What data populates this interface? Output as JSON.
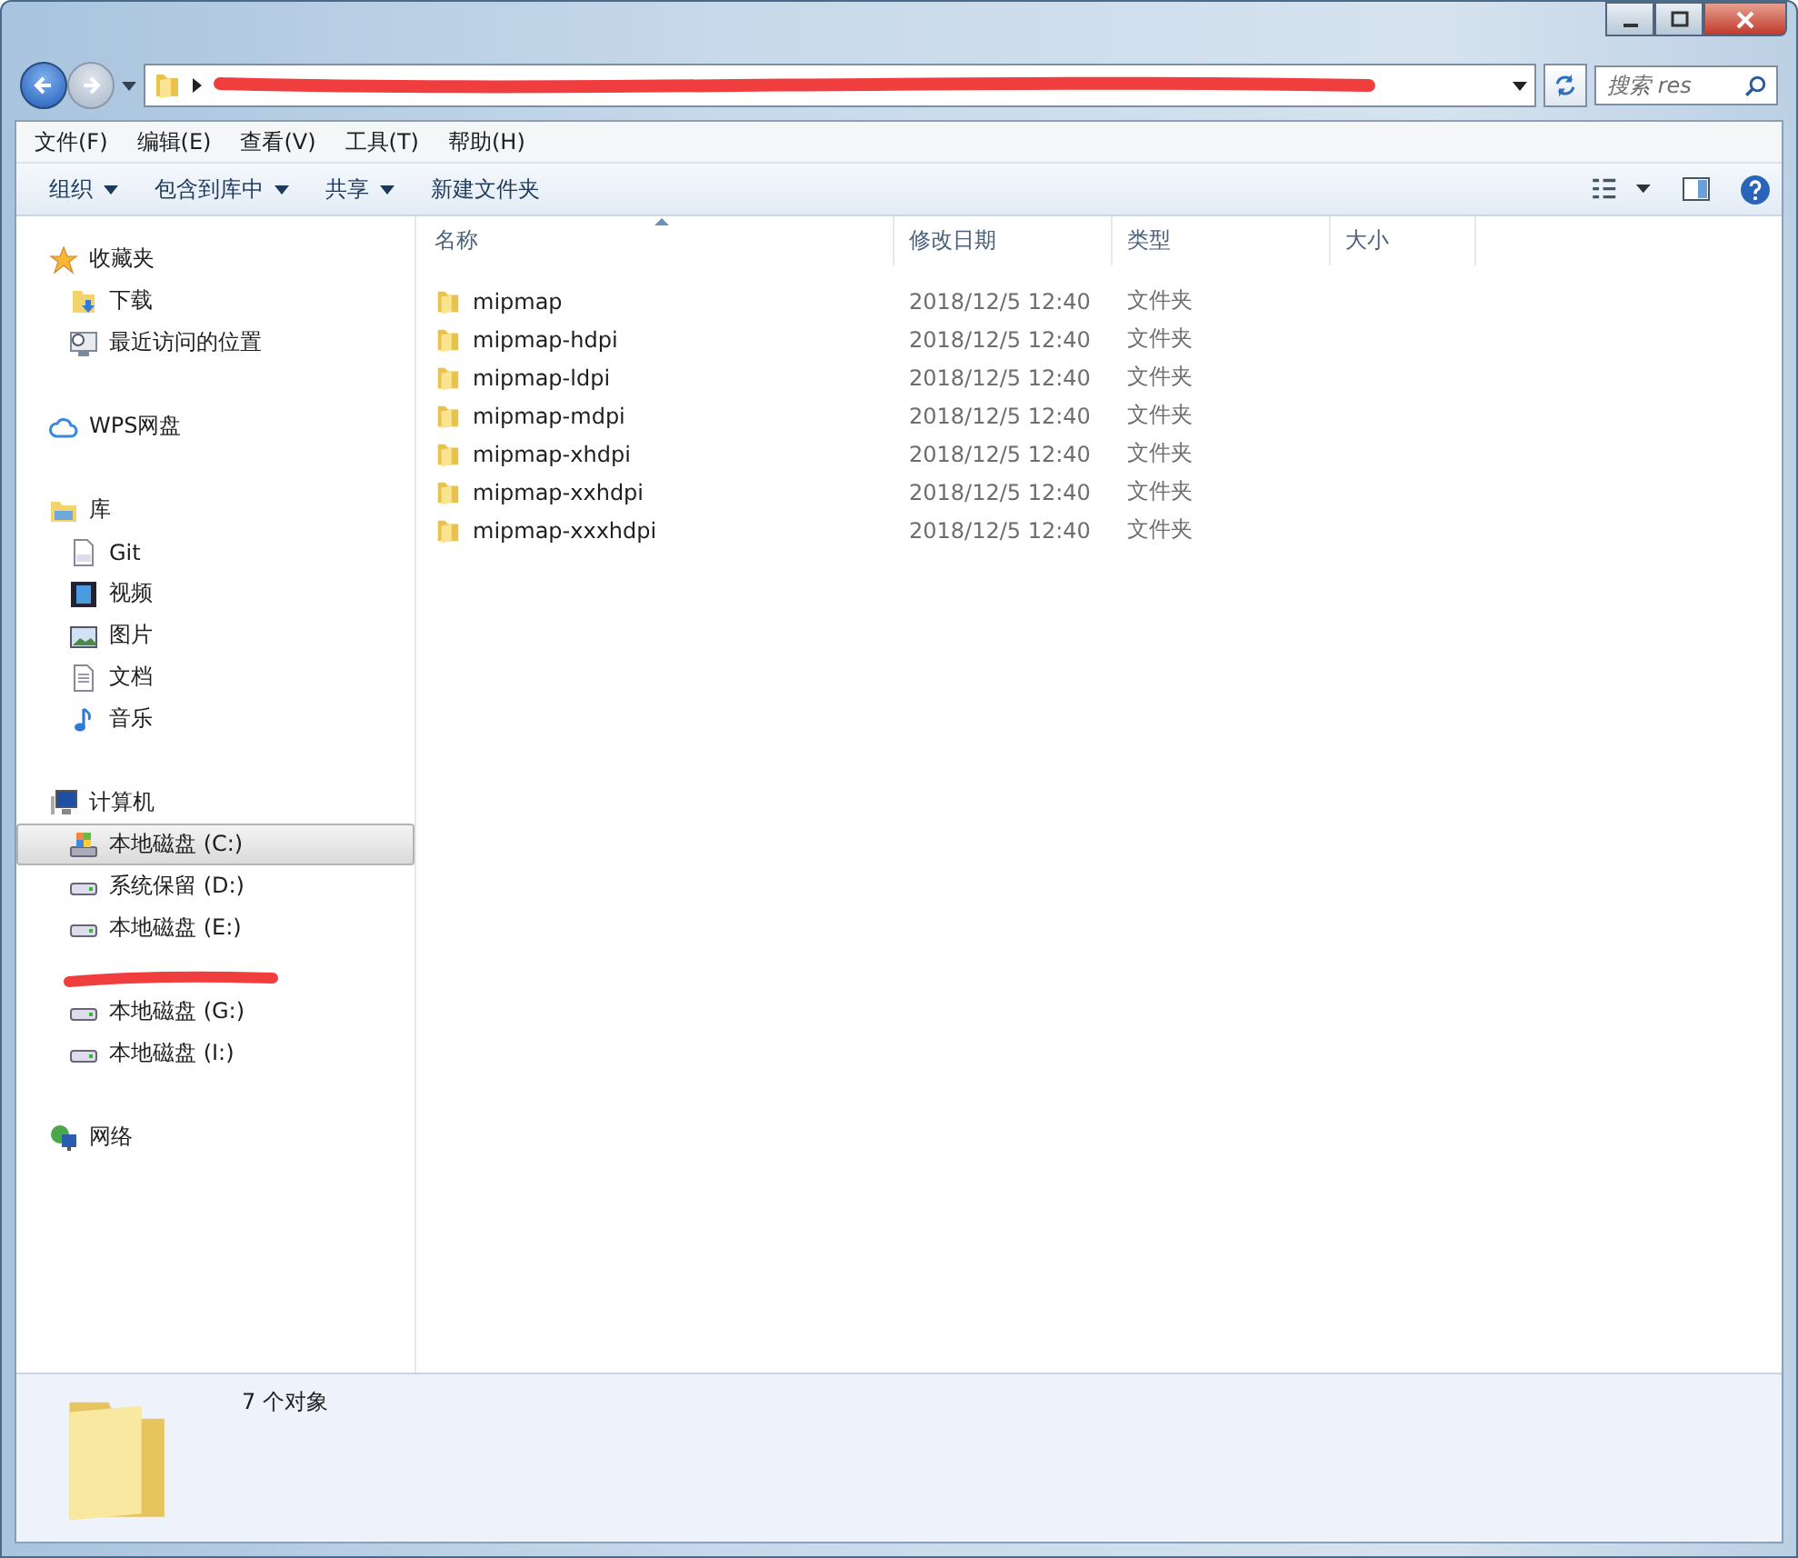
{
  "search": {
    "placeholder": "搜索 res"
  },
  "menu": [
    "文件(F)",
    "编辑(E)",
    "查看(V)",
    "工具(T)",
    "帮助(H)"
  ],
  "toolbar": [
    {
      "label": "组织",
      "dropdown": true
    },
    {
      "label": "包含到库中",
      "dropdown": true
    },
    {
      "label": "共享",
      "dropdown": true
    },
    {
      "label": "新建文件夹",
      "dropdown": false
    }
  ],
  "nav": [
    {
      "label": "收藏夹",
      "kind": "star",
      "selected": false,
      "children": [
        {
          "label": "下载",
          "kind": "download",
          "selected": false
        },
        {
          "label": "最近访问的位置",
          "kind": "recent",
          "selected": false
        }
      ]
    },
    {
      "label": "WPS网盘",
      "kind": "cloud",
      "selected": false
    },
    {
      "label": "库",
      "kind": "library",
      "selected": false,
      "children": [
        {
          "label": "Git",
          "kind": "git",
          "selected": false
        },
        {
          "label": "视频",
          "kind": "video",
          "selected": false
        },
        {
          "label": "图片",
          "kind": "image",
          "selected": false
        },
        {
          "label": "文档",
          "kind": "document",
          "selected": false
        },
        {
          "label": "音乐",
          "kind": "music",
          "selected": false
        }
      ]
    },
    {
      "label": "计算机",
      "kind": "computer",
      "selected": false,
      "children": [
        {
          "label": "本地磁盘 (C:)",
          "kind": "system-drive",
          "selected": true
        },
        {
          "label": "系统保留 (D:)",
          "kind": "drive",
          "selected": false
        },
        {
          "label": "本地磁盘 (E:)",
          "kind": "drive",
          "selected": false
        },
        {
          "kind": "redacted"
        },
        {
          "label": "本地磁盘 (G:)",
          "kind": "drive",
          "selected": false
        },
        {
          "label": "本地磁盘 (I:)",
          "kind": "drive",
          "selected": false
        }
      ]
    },
    {
      "label": "网络",
      "kind": "network",
      "selected": false
    }
  ],
  "columns": [
    {
      "label": "名称",
      "sorted": true
    },
    {
      "label": "修改日期",
      "sorted": false
    },
    {
      "label": "类型",
      "sorted": false
    },
    {
      "label": "大小",
      "sorted": false
    }
  ],
  "files": [
    {
      "name": "mipmap",
      "date": "2018/12/5 12:40",
      "type": "文件夹"
    },
    {
      "name": "mipmap-hdpi",
      "date": "2018/12/5 12:40",
      "type": "文件夹"
    },
    {
      "name": "mipmap-ldpi",
      "date": "2018/12/5 12:40",
      "type": "文件夹"
    },
    {
      "name": "mipmap-mdpi",
      "date": "2018/12/5 12:40",
      "type": "文件夹"
    },
    {
      "name": "mipmap-xhdpi",
      "date": "2018/12/5 12:40",
      "type": "文件夹"
    },
    {
      "name": "mipmap-xxhdpi",
      "date": "2018/12/5 12:40",
      "type": "文件夹"
    },
    {
      "name": "mipmap-xxxhdpi",
      "date": "2018/12/5 12:40",
      "type": "文件夹"
    }
  ],
  "status": "7 个对象"
}
